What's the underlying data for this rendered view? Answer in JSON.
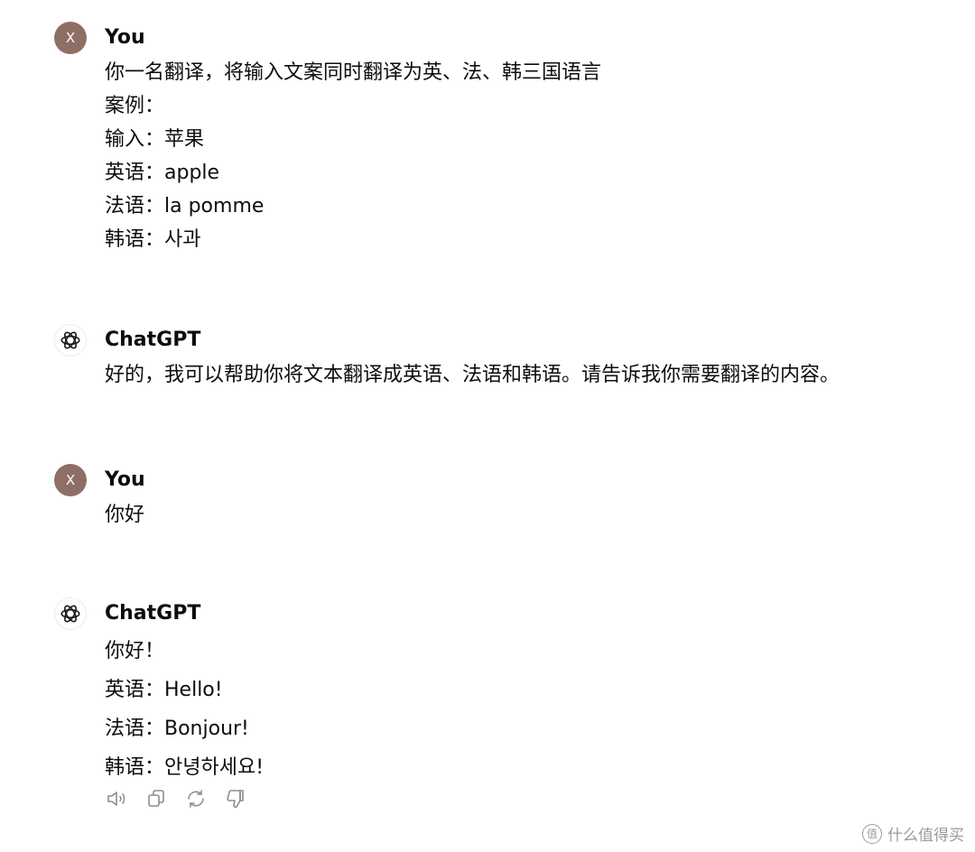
{
  "messages": [
    {
      "avatar": "X",
      "author": "You",
      "lines": [
        "你一名翻译，将输入文案同时翻译为英、法、韩三国语言",
        "案例：",
        "输入：苹果",
        "英语：apple",
        "法语：la pomme",
        "韩语：사과"
      ]
    },
    {
      "author": "ChatGPT",
      "lines": [
        "好的，我可以帮助你将文本翻译成英语、法语和韩语。请告诉我你需要翻译的内容。"
      ]
    },
    {
      "avatar": "X",
      "author": "You",
      "lines": [
        "你好"
      ]
    },
    {
      "author": "ChatGPT",
      "lines": [
        "你好！",
        "英语：Hello!",
        "法语：Bonjour!",
        "韩语：안녕하세요!"
      ]
    }
  ],
  "action_icons": [
    "speaker-icon",
    "copy-icon",
    "regenerate-icon",
    "thumbs-down-icon"
  ],
  "watermark": {
    "logo_text": "值",
    "text": "什么值得买"
  },
  "colors": {
    "user_avatar": "#8f6e66",
    "text": "#0d0d0d",
    "icon": "#8e8e8e",
    "watermark": "#9a9a9a"
  }
}
